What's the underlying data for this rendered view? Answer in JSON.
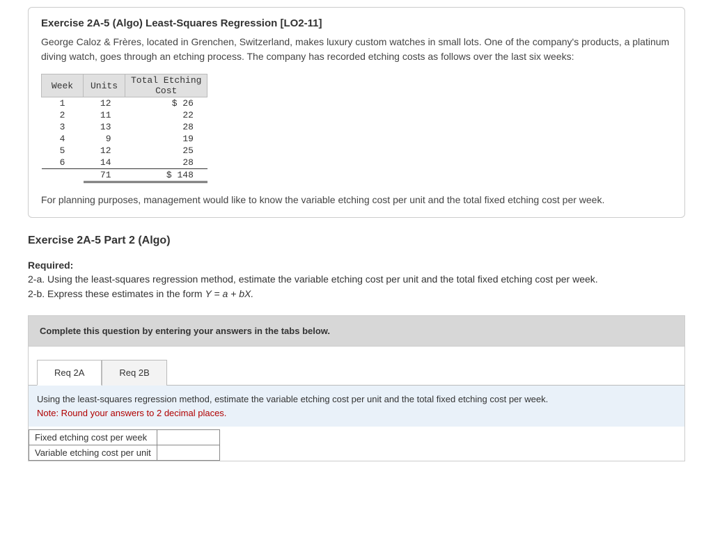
{
  "exercise": {
    "title": "Exercise 2A-5 (Algo) Least-Squares Regression [LO2-11]",
    "description": "George Caloz & Frères, located in Grenchen, Switzerland, makes luxury custom watches in small lots. One of the company's products, a platinum diving watch, goes through an etching process. The company has recorded etching costs as follows over the last six weeks:",
    "closing": "For planning purposes, management would like to know the variable etching cost per unit and the total fixed etching cost per week."
  },
  "chart_data": {
    "type": "table",
    "columns": [
      "Week",
      "Units",
      "Total Etching Cost"
    ],
    "rows": [
      {
        "week": "1",
        "units": "12",
        "cost": "$ 26"
      },
      {
        "week": "2",
        "units": "11",
        "cost": "22"
      },
      {
        "week": "3",
        "units": "13",
        "cost": "28"
      },
      {
        "week": "4",
        "units": "9",
        "cost": "19"
      },
      {
        "week": "5",
        "units": "12",
        "cost": "25"
      },
      {
        "week": "6",
        "units": "14",
        "cost": "28"
      }
    ],
    "totals": {
      "units": "71",
      "cost": "$ 148"
    }
  },
  "part2": {
    "title": "Exercise 2A-5 Part 2 (Algo)",
    "required_label": "Required:",
    "req_a": "2-a. Using the least-squares regression method, estimate the variable etching cost per unit and the total fixed etching cost per week.",
    "req_b_prefix": "2-b. Express these estimates in the form ",
    "req_b_formula": "Y = a + bX."
  },
  "answer": {
    "instruction": "Complete this question by entering your answers in the tabs below.",
    "tabs": {
      "a": "Req 2A",
      "b": "Req 2B"
    },
    "prompt": "Using the least-squares regression method, estimate the variable etching cost per unit and the total fixed etching cost per week.",
    "note": "Note: Round your answers to 2 decimal places.",
    "rows": {
      "fixed": "Fixed etching cost per week",
      "variable": "Variable etching cost per unit"
    }
  }
}
